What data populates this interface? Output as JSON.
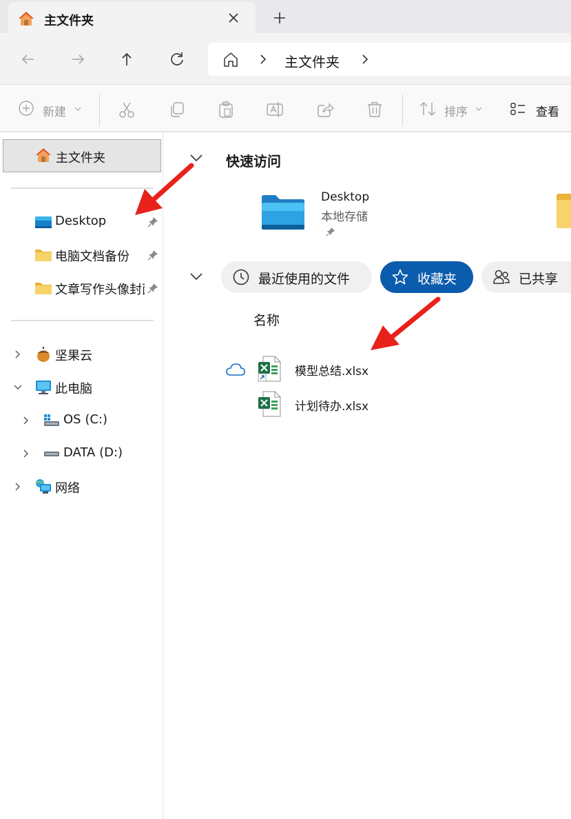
{
  "window": {
    "tab_title": "主文件夹",
    "tab_icon": "home-icon",
    "close_icon": "close-icon",
    "new_tab_icon": "plus-icon"
  },
  "nav": {
    "back_icon": "back-arrow-icon",
    "forward_icon": "forward-arrow-icon",
    "up_icon": "up-arrow-icon",
    "refresh_icon": "refresh-icon",
    "breadcrumb": [
      "主文件夹"
    ]
  },
  "toolbar": {
    "new_label": "新建",
    "sort_label": "排序",
    "view_label": "查看",
    "icons": [
      "plus-circle-icon",
      "cut-icon",
      "copy-icon",
      "paste-icon",
      "rename-icon",
      "share-icon",
      "delete-icon",
      "sort-icon",
      "view-icon"
    ]
  },
  "sidebar": {
    "home_label": "主文件夹",
    "pinned": [
      {
        "label": "Desktop",
        "icon": "desktop-folder-icon",
        "pinned": true
      },
      {
        "label": "电脑文档备份",
        "icon": "folder-icon",
        "pinned": true
      },
      {
        "label": "文章写作头像封面",
        "icon": "folder-icon",
        "pinned": true
      }
    ],
    "tree": [
      {
        "label": "坚果云",
        "icon": "nutstore-icon",
        "expanded": false
      },
      {
        "label": "此电脑",
        "icon": "computer-icon",
        "expanded": true
      },
      {
        "label": "OS (C:)",
        "icon": "windows-drive-icon",
        "expanded": false
      },
      {
        "label": "DATA (D:)",
        "icon": "drive-icon",
        "expanded": false
      },
      {
        "label": "网络",
        "icon": "network-icon",
        "expanded": false
      }
    ]
  },
  "content": {
    "quick_access": {
      "title": "快速访问",
      "items": [
        {
          "name": "Desktop",
          "location": "本地存储",
          "pinned": true
        }
      ]
    },
    "tabs": [
      {
        "label": "最近使用的文件",
        "icon": "clock-icon",
        "active": false
      },
      {
        "label": "收藏夹",
        "icon": "star-icon",
        "active": true
      },
      {
        "label": "已共享",
        "icon": "people-icon",
        "active": false
      }
    ],
    "column_name": "名称",
    "files": [
      {
        "name": "模型总结.xlsx",
        "cloud": true,
        "shortcut": true
      },
      {
        "name": "计划待办.xlsx",
        "cloud": false,
        "shortcut": false
      }
    ]
  },
  "colors": {
    "accent": "#0b5cad",
    "arrow": "#e8221b",
    "folder": "#f7c948",
    "excel": "#1e7145"
  }
}
